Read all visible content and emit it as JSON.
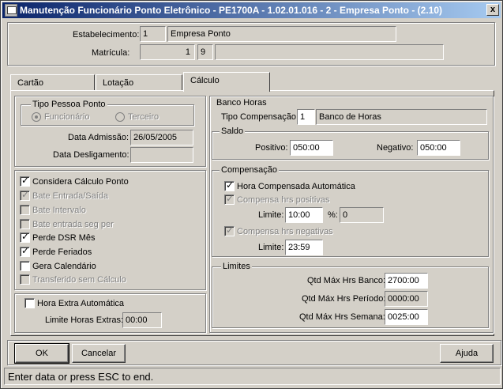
{
  "window": {
    "title": "Manutenção Funcionário Ponto Eletrônico - PE1700A - 1.02.01.016 - 2 - Empresa Ponto - (2.10)",
    "close_label": "x"
  },
  "header": {
    "estabelecimento_label": "Estabelecimento:",
    "estabelecimento_code": "1",
    "estabelecimento_name": "Empresa Ponto",
    "matricula_label": "Matrícula:",
    "matricula_number": "1",
    "matricula_digit": "9",
    "matricula_name": ""
  },
  "tabs": [
    {
      "label": "Cartão",
      "active": false
    },
    {
      "label": "Lotação",
      "active": false
    },
    {
      "label": "Cálculo",
      "active": true
    }
  ],
  "tipo_pessoa": {
    "title": "Tipo Pessoa Ponto",
    "option1": "Funcionário",
    "option2": "Terceiro",
    "selected": "Funcionário"
  },
  "datas": {
    "admissao_label": "Data Admissão:",
    "admissao_value": "26/05/2005",
    "desligamento_label": "Data Desligamento:",
    "desligamento_value": ""
  },
  "checks": [
    {
      "label": "Considera Cálculo Ponto",
      "checked": true,
      "disabled": false
    },
    {
      "label": "Bate Entrada/Saída",
      "checked": true,
      "disabled": true
    },
    {
      "label": "Bate Intervalo",
      "checked": false,
      "disabled": true
    },
    {
      "label": "Bate entrada seg per",
      "checked": false,
      "disabled": true
    },
    {
      "label": "Perde DSR Mês",
      "checked": true,
      "disabled": false
    },
    {
      "label": "Perde Feriados",
      "checked": true,
      "disabled": false
    },
    {
      "label": "Gera Calendário",
      "checked": false,
      "disabled": false
    },
    {
      "label": "Transferido sem Cálculo",
      "checked": false,
      "disabled": true
    }
  ],
  "hora_extra": {
    "label": "Hora Extra Automática",
    "checked": false,
    "limite_label": "Limite Horas Extras:",
    "limite_value": "00:00"
  },
  "banco_horas": {
    "title": "Banco Horas",
    "tipo_label": "Tipo Compensação:",
    "tipo_code": "1",
    "tipo_name": "Banco de Horas"
  },
  "saldo": {
    "title": "Saldo",
    "positivo_label": "Positivo:",
    "positivo_value": "050:00",
    "negativo_label": "Negativo:",
    "negativo_value": "050:00"
  },
  "compensacao": {
    "title": "Compensação",
    "hora_compensada_label": "Hora Compensada Automática",
    "compensa_positivas_label": "Compensa hrs positivas",
    "limite_label": "Limite:",
    "limite_pos_value": "10:00",
    "percent_label": "%:",
    "percent_value": "0",
    "compensa_negativas_label": "Compensa hrs negativas",
    "limite_neg_value": "23:59"
  },
  "limites": {
    "title": "Limites",
    "banco_label": "Qtd Máx Hrs Banco:",
    "banco_value": "2700:00",
    "periodo_label": "Qtd Máx Hrs Período:",
    "periodo_value": "0000:00",
    "semana_label": "Qtd Máx Hrs Semana:",
    "semana_value": "0025:00"
  },
  "buttons": {
    "ok": "OK",
    "cancelar": "Cancelar",
    "ajuda": "Ajuda"
  },
  "status": "Enter data or press ESC to end."
}
